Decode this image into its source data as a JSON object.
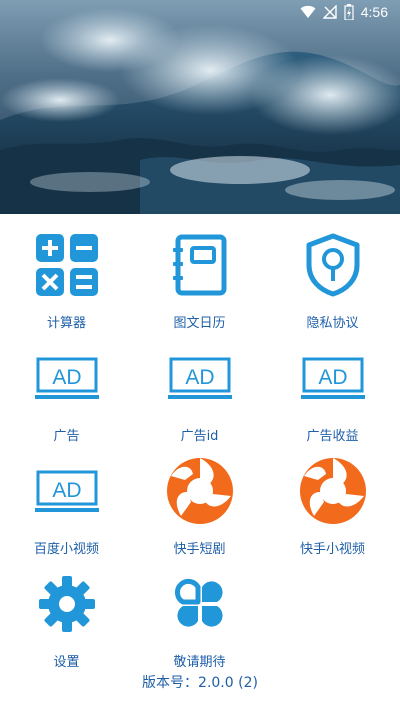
{
  "status_bar": {
    "time": "4:56",
    "icons": [
      "wifi-icon",
      "signal-icon",
      "battery-icon"
    ]
  },
  "colors": {
    "accent": "#2196d8",
    "label": "#1f5fa8",
    "kuaishou_orange": "#f26a1b"
  },
  "grid": {
    "items": [
      {
        "label": "计算器",
        "icon": "calculator-icon"
      },
      {
        "label": "图文日历",
        "icon": "notebook-icon"
      },
      {
        "label": "隐私协议",
        "icon": "shield-lock-icon"
      },
      {
        "label": "广告",
        "icon": "ad-icon"
      },
      {
        "label": "广告id",
        "icon": "ad-icon"
      },
      {
        "label": "广告收益",
        "icon": "ad-icon"
      },
      {
        "label": "百度小视频",
        "icon": "ad-icon"
      },
      {
        "label": "快手短剧",
        "icon": "kuaishou-logo-icon"
      },
      {
        "label": "快手小视频",
        "icon": "kuaishou-logo-icon"
      },
      {
        "label": "设置",
        "icon": "gear-icon"
      },
      {
        "label": "敬请期待",
        "icon": "coming-soon-icon"
      }
    ]
  },
  "version": "版本号：2.0.0 (2)"
}
